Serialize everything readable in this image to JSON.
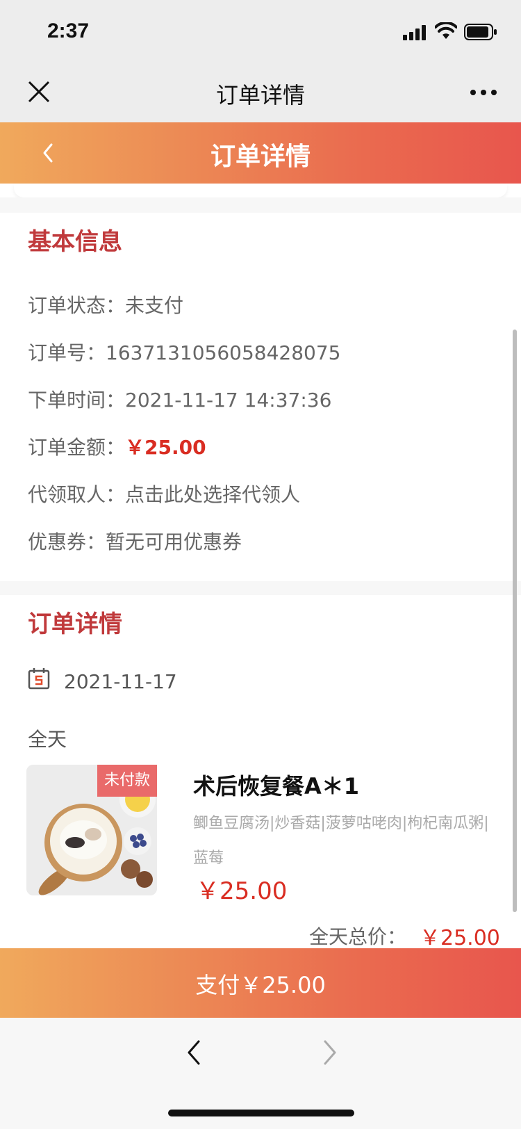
{
  "status_bar": {
    "time": "2:37"
  },
  "wechat_nav": {
    "title": "订单详情"
  },
  "header": {
    "title": "订单详情"
  },
  "basic_info": {
    "title": "基本信息",
    "order_status": {
      "label": "订单状态：",
      "value": "未支付"
    },
    "order_number": {
      "label": "订单号：",
      "value": "1637131056058428075"
    },
    "order_time": {
      "label": "下单时间：",
      "value": "2021-11-17 14:37:36"
    },
    "order_amount": {
      "label": "订单金额：",
      "value": "￥25.00"
    },
    "pickup_person": {
      "label": "代领取人：",
      "value": "点击此处选择代领人"
    },
    "coupon": {
      "label": "优惠券：",
      "value": "暂无可用优惠券"
    }
  },
  "order_detail": {
    "title": "订单详情",
    "date": "2021-11-17",
    "period": "全天",
    "item": {
      "badge": "未付款",
      "name": "术后恢复餐A＊1",
      "description": "鲫鱼豆腐汤|炒香菇|菠萝咕咾肉|枸杞南瓜粥|蓝莓",
      "price": "￥25.00"
    },
    "total_label": "全天总价：",
    "total_value": "￥25.00"
  },
  "pay_button": {
    "label": "支付￥25.00"
  },
  "colors": {
    "accent_red": "#d92d22",
    "section_title": "#c0393b",
    "gradient_start": "#f0a95c",
    "gradient_end": "#e8564d"
  }
}
